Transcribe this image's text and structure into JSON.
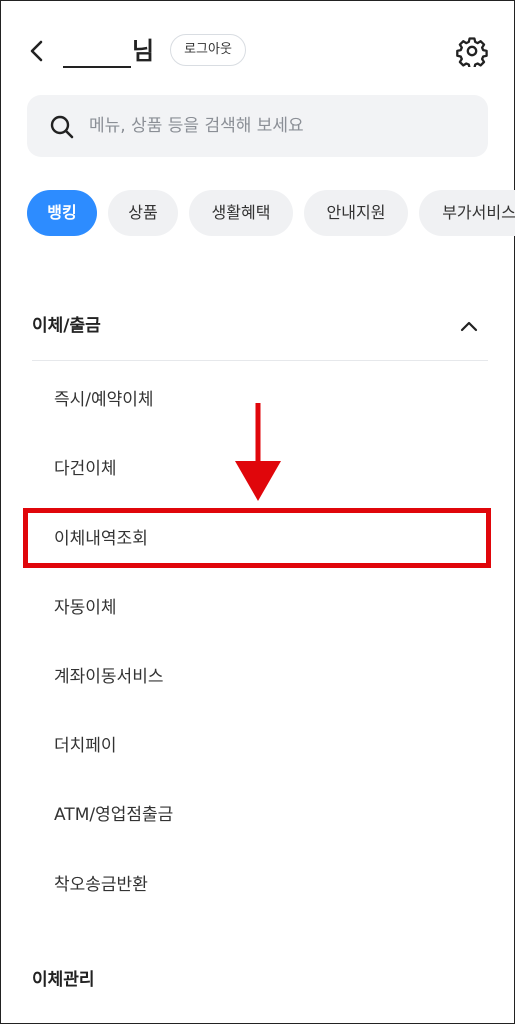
{
  "header": {
    "user_suffix": "님",
    "logout_label": "로그아웃"
  },
  "search": {
    "placeholder": "메뉴, 상품 등을 검색해 보세요"
  },
  "categories": [
    {
      "label": "뱅킹",
      "active": true
    },
    {
      "label": "상품",
      "active": false
    },
    {
      "label": "생활혜택",
      "active": false
    },
    {
      "label": "안내지원",
      "active": false
    },
    {
      "label": "부가서비스",
      "active": false
    }
  ],
  "sections": [
    {
      "title": "이체/출금",
      "expanded": true,
      "items": [
        "즉시/예약이체",
        "다건이체",
        "이체내역조회",
        "자동이체",
        "계좌이동서비스",
        "더치페이",
        "ATM/영업점출금",
        "착오송금반환"
      ]
    },
    {
      "title": "이체관리"
    }
  ],
  "colors": {
    "accent": "#2d8cff",
    "highlight": "#e0060b",
    "chip_bg": "#f0f1f3",
    "search_bg": "#f2f3f5"
  },
  "icons": {
    "back": "chevron-left-icon",
    "settings": "gear-icon",
    "search": "search-icon",
    "collapse": "chevron-up-icon",
    "annotation": "down-arrow"
  }
}
